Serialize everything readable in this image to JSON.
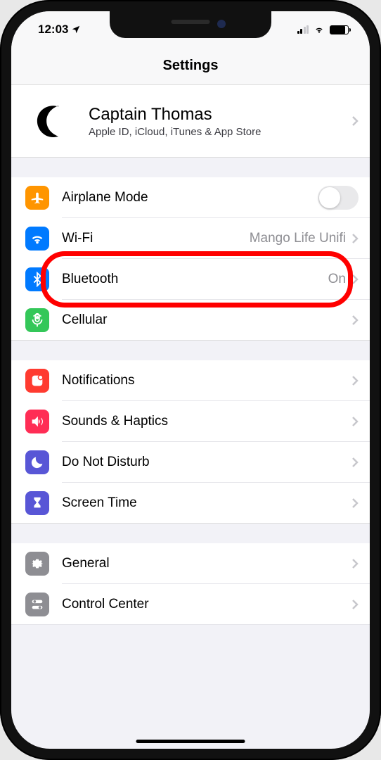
{
  "status": {
    "time": "12:03",
    "location_arrow": "➤"
  },
  "header": {
    "title": "Settings"
  },
  "profile": {
    "name": "Captain Thomas",
    "subtitle": "Apple ID, iCloud, iTunes & App Store",
    "avatar_glyph": "☾"
  },
  "groups": [
    {
      "rows": [
        {
          "icon": "airplane",
          "label": "Airplane Mode",
          "type": "toggle",
          "toggle_on": false
        },
        {
          "icon": "wifi",
          "label": "Wi-Fi",
          "type": "link",
          "value": "Mango Life Unifi"
        },
        {
          "icon": "bluetooth",
          "label": "Bluetooth",
          "type": "link",
          "value": "On",
          "highlighted": true
        },
        {
          "icon": "cellular",
          "label": "Cellular",
          "type": "link"
        }
      ]
    },
    {
      "rows": [
        {
          "icon": "notifications",
          "label": "Notifications",
          "type": "link"
        },
        {
          "icon": "sounds",
          "label": "Sounds & Haptics",
          "type": "link"
        },
        {
          "icon": "dnd",
          "label": "Do Not Disturb",
          "type": "link"
        },
        {
          "icon": "screentime",
          "label": "Screen Time",
          "type": "link"
        }
      ]
    },
    {
      "rows": [
        {
          "icon": "general",
          "label": "General",
          "type": "link"
        },
        {
          "icon": "control-center",
          "label": "Control Center",
          "type": "link"
        }
      ]
    }
  ]
}
